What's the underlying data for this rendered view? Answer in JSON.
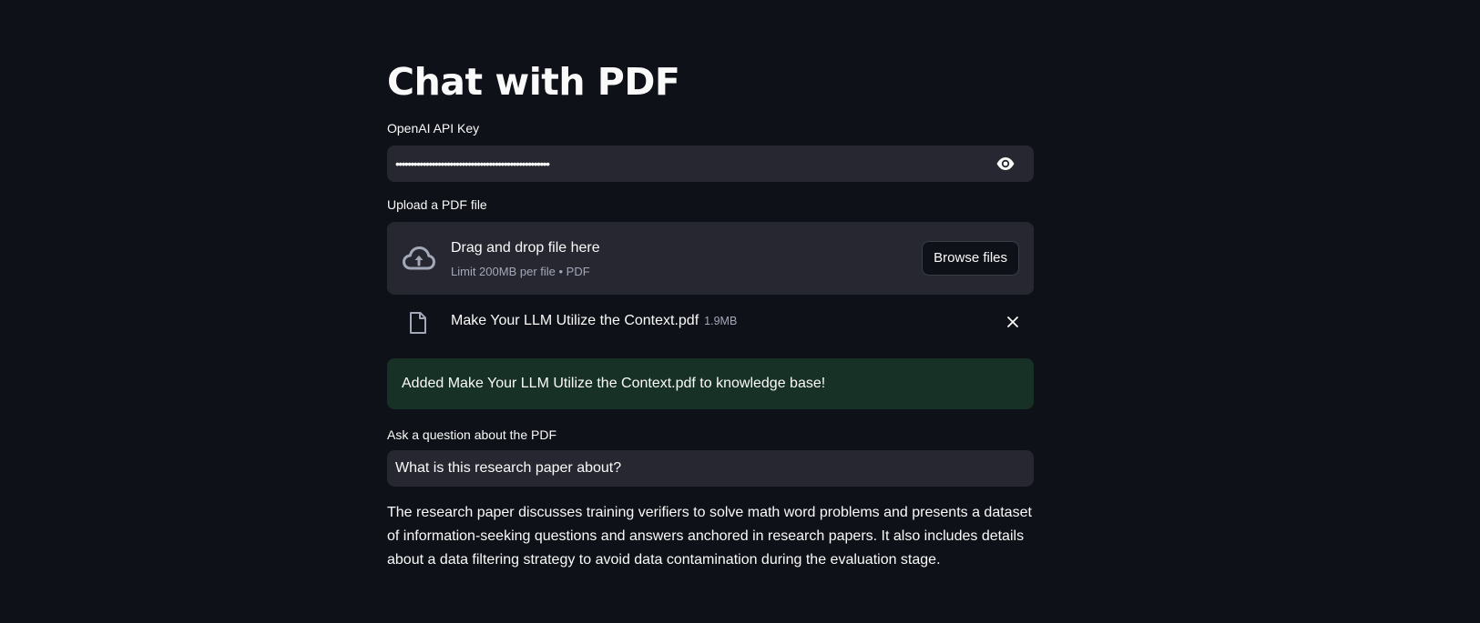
{
  "title": "Chat with PDF",
  "api_key": {
    "label": "OpenAI API Key",
    "masked_value": "•••••••••••••••••••••••••••••••••••••••••••••••••••",
    "toggle_icon": "eye-icon"
  },
  "uploader": {
    "label": "Upload a PDF file",
    "drop_text": "Drag and drop file here",
    "limit_text": "Limit 200MB per file • PDF",
    "browse_label": "Browse files",
    "icon": "cloud-upload-icon"
  },
  "uploaded_file": {
    "name": "Make Your LLM Utilize the Context.pdf",
    "size": "1.9MB",
    "icon": "file-icon",
    "remove_icon": "close-icon"
  },
  "success_message": "Added Make Your LLM Utilize the Context.pdf to knowledge base!",
  "question": {
    "label": "Ask a question about the PDF",
    "value": "What is this research paper about?"
  },
  "answer": "The research paper discusses training verifiers to solve math word problems and presents a dataset of information-seeking questions and answers anchored in research papers. It also includes details about a data filtering strategy to avoid data contamination during the evaluation stage.",
  "colors": {
    "background": "#0e1117",
    "input_background": "#262730",
    "success_background": "#183126",
    "text": "#fafafa",
    "muted_text": "#a3a8b8"
  }
}
